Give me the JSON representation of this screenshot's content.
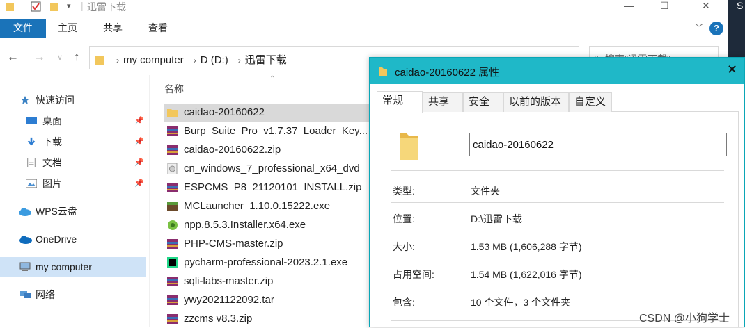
{
  "window": {
    "title": "迅雷下载",
    "controls": {
      "minimize": "—",
      "maximize": "☐",
      "close": "✕"
    }
  },
  "ribbon": {
    "file_tab": "文件",
    "tabs": [
      "主页",
      "共享",
      "查看"
    ],
    "help": "?"
  },
  "address": {
    "crumbs": [
      "my computer",
      "D (D:)",
      "迅雷下载"
    ],
    "search_placeholder": "搜索\"迅雷下载\""
  },
  "nav": {
    "items": [
      {
        "label": "快速访问",
        "icon": "star-icon"
      },
      {
        "label": "桌面",
        "icon": "desktop-icon",
        "pinned": true
      },
      {
        "label": "下载",
        "icon": "download-icon",
        "pinned": true
      },
      {
        "label": "文档",
        "icon": "document-icon",
        "pinned": true
      },
      {
        "label": "图片",
        "icon": "picture-icon",
        "pinned": true
      },
      {
        "label": "WPS云盘",
        "icon": "cloud-icon"
      },
      {
        "label": "OneDrive",
        "icon": "onedrive-icon"
      },
      {
        "label": "my computer",
        "icon": "computer-icon"
      },
      {
        "label": "网络",
        "icon": "network-icon"
      }
    ]
  },
  "files": {
    "column_name": "名称",
    "rows": [
      {
        "name": "caidao-20160622",
        "icon": "folder-icon"
      },
      {
        "name": "Burp_Suite_Pro_v1.7.37_Loader_Key...",
        "icon": "archive-icon"
      },
      {
        "name": "caidao-20160622.zip",
        "icon": "archive-icon"
      },
      {
        "name": "cn_windows_7_professional_x64_dvd",
        "icon": "disc-icon"
      },
      {
        "name": "ESPCMS_P8_21120101_INSTALL.zip",
        "icon": "archive-icon"
      },
      {
        "name": "MCLauncher_1.10.0.15222.exe",
        "icon": "minecraft-icon"
      },
      {
        "name": "npp.8.5.3.Installer.x64.exe",
        "icon": "notepad-icon"
      },
      {
        "name": "PHP-CMS-master.zip",
        "icon": "archive-icon"
      },
      {
        "name": "pycharm-professional-2023.2.1.exe",
        "icon": "pycharm-icon"
      },
      {
        "name": "sqli-labs-master.zip",
        "icon": "archive-icon"
      },
      {
        "name": "ywy2021122092.tar",
        "icon": "archive-icon"
      },
      {
        "name": "zzcms v8.3.zip",
        "icon": "archive-icon"
      }
    ]
  },
  "dialog": {
    "title": "caidao-20160622 属性",
    "tabs": [
      "常规",
      "共享",
      "安全",
      "以前的版本",
      "自定义"
    ],
    "name_value": "caidao-20160622",
    "props": [
      {
        "label": "类型:",
        "value": "文件夹"
      },
      {
        "label": "位置:",
        "value": "D:\\迅雷下载"
      },
      {
        "label": "大小:",
        "value": "1.53 MB (1,606,288 字节)"
      },
      {
        "label": "占用空间:",
        "value": "1.54 MB (1,622,016 字节)"
      },
      {
        "label": "包含:",
        "value": "10 个文件，3 个文件夹"
      }
    ]
  },
  "watermark": "CSDN @小狗学士",
  "colors": {
    "accent": "#1a73b9",
    "dialog_title": "#1fb8c8",
    "folder": "#f2c75c"
  }
}
